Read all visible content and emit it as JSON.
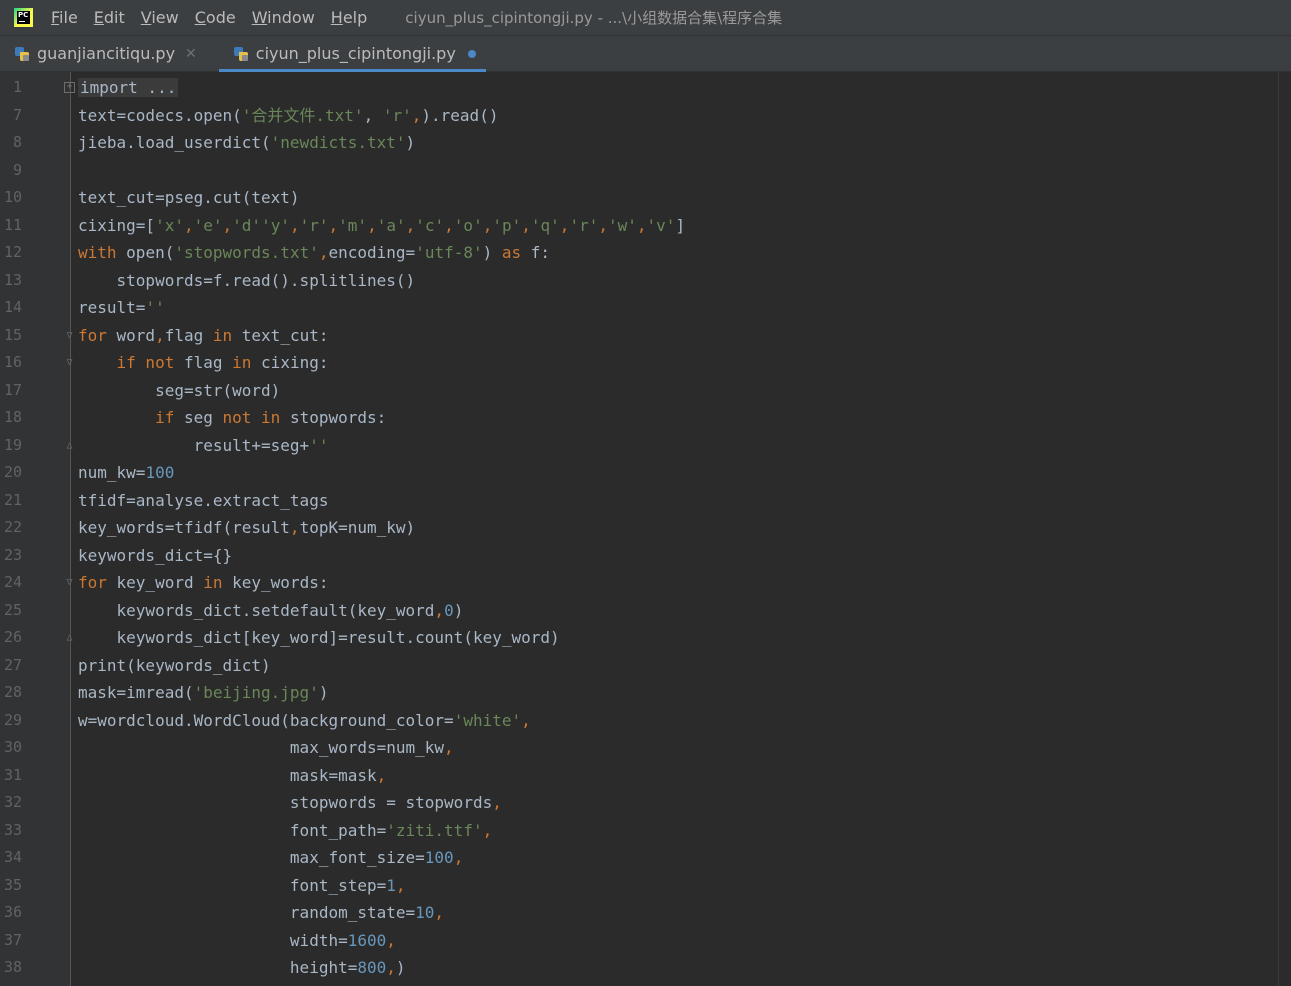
{
  "menu": {
    "items": [
      {
        "mnemonic": "F",
        "rest": "ile"
      },
      {
        "mnemonic": "E",
        "rest": "dit"
      },
      {
        "mnemonic": "V",
        "rest": "iew"
      },
      {
        "mnemonic": "C",
        "rest": "ode"
      },
      {
        "mnemonic": "W",
        "rest": "indow"
      },
      {
        "mnemonic": "H",
        "rest": "elp"
      }
    ],
    "window_title": "ciyun_plus_cipintongji.py - ...\\小组数据合集\\程序合集"
  },
  "tabs": [
    {
      "label": "guanjiancitiqu.py",
      "active": false,
      "modified": false
    },
    {
      "label": "ciyun_plus_cipintongji.py",
      "active": true,
      "modified": true
    }
  ],
  "editor": {
    "lines": [
      {
        "num": "1",
        "fold": "box-plus",
        "tokens": [
          [
            "f",
            "import ..."
          ]
        ]
      },
      {
        "num": "7",
        "fold": "",
        "tokens": [
          [
            "p",
            "text=codecs.open("
          ],
          [
            "s",
            "'合并文件.txt'"
          ],
          [
            "p",
            ", "
          ],
          [
            "s",
            "'r'"
          ],
          [
            "k",
            ","
          ],
          [
            "p",
            ").read()"
          ]
        ]
      },
      {
        "num": "8",
        "fold": "",
        "tokens": [
          [
            "p",
            "jieba.load_userdict("
          ],
          [
            "s",
            "'newdicts.txt'"
          ],
          [
            "p",
            ")"
          ]
        ]
      },
      {
        "num": "9",
        "fold": "",
        "tokens": []
      },
      {
        "num": "10",
        "fold": "",
        "tokens": [
          [
            "p",
            "text_cut=pseg.cut(text)"
          ]
        ]
      },
      {
        "num": "11",
        "fold": "",
        "tokens": [
          [
            "p",
            "cixing=["
          ],
          [
            "s",
            "'x'"
          ],
          [
            "k",
            ","
          ],
          [
            "s",
            "'e'"
          ],
          [
            "k",
            ","
          ],
          [
            "s",
            "'d'"
          ],
          [
            "s",
            "'y'"
          ],
          [
            "k",
            ","
          ],
          [
            "s",
            "'r'"
          ],
          [
            "k",
            ","
          ],
          [
            "s",
            "'m'"
          ],
          [
            "k",
            ","
          ],
          [
            "s",
            "'a'"
          ],
          [
            "k",
            ","
          ],
          [
            "s",
            "'c'"
          ],
          [
            "k",
            ","
          ],
          [
            "s",
            "'o'"
          ],
          [
            "k",
            ","
          ],
          [
            "s",
            "'p'"
          ],
          [
            "k",
            ","
          ],
          [
            "s",
            "'q'"
          ],
          [
            "k",
            ","
          ],
          [
            "s",
            "'r'"
          ],
          [
            "k",
            ","
          ],
          [
            "s",
            "'w'"
          ],
          [
            "k",
            ","
          ],
          [
            "s",
            "'v'"
          ],
          [
            "p",
            "]"
          ]
        ]
      },
      {
        "num": "12",
        "fold": "",
        "tokens": [
          [
            "k",
            "with "
          ],
          [
            "p",
            "open("
          ],
          [
            "s",
            "'stopwords.txt'"
          ],
          [
            "k",
            ","
          ],
          [
            "p",
            "encoding="
          ],
          [
            "s",
            "'utf-8'"
          ],
          [
            "p",
            ") "
          ],
          [
            "k",
            "as "
          ],
          [
            "p",
            "f:"
          ]
        ]
      },
      {
        "num": "13",
        "fold": "",
        "tokens": [
          [
            "p",
            "    stopwords=f.read().splitlines()"
          ]
        ]
      },
      {
        "num": "14",
        "fold": "",
        "tokens": [
          [
            "p",
            "result="
          ],
          [
            "s",
            "''"
          ]
        ]
      },
      {
        "num": "15",
        "fold": "open",
        "tokens": [
          [
            "k",
            "for "
          ],
          [
            "p",
            "word"
          ],
          [
            "k",
            ","
          ],
          [
            "p",
            "flag "
          ],
          [
            "k",
            "in "
          ],
          [
            "p",
            "text_cut:"
          ]
        ]
      },
      {
        "num": "16",
        "fold": "open",
        "tokens": [
          [
            "p",
            "    "
          ],
          [
            "k",
            "if not "
          ],
          [
            "p",
            "flag "
          ],
          [
            "k",
            "in "
          ],
          [
            "p",
            "cixing:"
          ]
        ]
      },
      {
        "num": "17",
        "fold": "",
        "tokens": [
          [
            "p",
            "        seg=str(word)"
          ]
        ]
      },
      {
        "num": "18",
        "fold": "",
        "tokens": [
          [
            "p",
            "        "
          ],
          [
            "k",
            "if "
          ],
          [
            "p",
            "seg "
          ],
          [
            "k",
            "not in "
          ],
          [
            "p",
            "stopwords:"
          ]
        ]
      },
      {
        "num": "19",
        "fold": "close",
        "tokens": [
          [
            "p",
            "            result+=seg+"
          ],
          [
            "s",
            "''"
          ]
        ]
      },
      {
        "num": "20",
        "fold": "",
        "tokens": [
          [
            "p",
            "num_kw="
          ],
          [
            "n",
            "100"
          ]
        ]
      },
      {
        "num": "21",
        "fold": "",
        "tokens": [
          [
            "p",
            "tfidf=analyse.extract_tags"
          ]
        ]
      },
      {
        "num": "22",
        "fold": "",
        "tokens": [
          [
            "p",
            "key_words=tfidf(result"
          ],
          [
            "k",
            ","
          ],
          [
            "p",
            "topK=num_kw)"
          ]
        ]
      },
      {
        "num": "23",
        "fold": "",
        "tokens": [
          [
            "p",
            "keywords_dict={}"
          ]
        ]
      },
      {
        "num": "24",
        "fold": "open",
        "tokens": [
          [
            "k",
            "for "
          ],
          [
            "p",
            "key_word "
          ],
          [
            "k",
            "in "
          ],
          [
            "p",
            "key_words:"
          ]
        ]
      },
      {
        "num": "25",
        "fold": "",
        "tokens": [
          [
            "p",
            "    keywords_dict.setdefault(key_word"
          ],
          [
            "k",
            ","
          ],
          [
            "n",
            "0"
          ],
          [
            "p",
            ")"
          ]
        ]
      },
      {
        "num": "26",
        "fold": "close",
        "tokens": [
          [
            "p",
            "    keywords_dict[key_word]=result.count(key_word)"
          ]
        ]
      },
      {
        "num": "27",
        "fold": "",
        "tokens": [
          [
            "p",
            "print(keywords_dict)"
          ]
        ]
      },
      {
        "num": "28",
        "fold": "",
        "tokens": [
          [
            "p",
            "mask=imread("
          ],
          [
            "s",
            "'beijing.jpg'"
          ],
          [
            "p",
            ")"
          ]
        ]
      },
      {
        "num": "29",
        "fold": "",
        "tokens": [
          [
            "p",
            "w=wordcloud.WordCloud(background_color="
          ],
          [
            "s",
            "'white'"
          ],
          [
            "k",
            ","
          ]
        ]
      },
      {
        "num": "30",
        "fold": "",
        "tokens": [
          [
            "p",
            "                      max_words=num_kw"
          ],
          [
            "k",
            ","
          ]
        ]
      },
      {
        "num": "31",
        "fold": "",
        "tokens": [
          [
            "p",
            "                      mask=mask"
          ],
          [
            "k",
            ","
          ]
        ]
      },
      {
        "num": "32",
        "fold": "",
        "tokens": [
          [
            "p",
            "                      stopwords = stopwords"
          ],
          [
            "k",
            ","
          ]
        ]
      },
      {
        "num": "33",
        "fold": "",
        "tokens": [
          [
            "p",
            "                      font_path="
          ],
          [
            "s",
            "'ziti.ttf'"
          ],
          [
            "k",
            ","
          ]
        ]
      },
      {
        "num": "34",
        "fold": "",
        "tokens": [
          [
            "p",
            "                      max_font_size="
          ],
          [
            "n",
            "100"
          ],
          [
            "k",
            ","
          ]
        ]
      },
      {
        "num": "35",
        "fold": "",
        "tokens": [
          [
            "p",
            "                      font_step="
          ],
          [
            "n",
            "1"
          ],
          [
            "k",
            ","
          ]
        ]
      },
      {
        "num": "36",
        "fold": "",
        "tokens": [
          [
            "p",
            "                      random_state="
          ],
          [
            "n",
            "10"
          ],
          [
            "k",
            ","
          ]
        ]
      },
      {
        "num": "37",
        "fold": "",
        "tokens": [
          [
            "p",
            "                      width="
          ],
          [
            "n",
            "1600"
          ],
          [
            "k",
            ","
          ]
        ]
      },
      {
        "num": "38",
        "fold": "",
        "tokens": [
          [
            "p",
            "                      height="
          ],
          [
            "n",
            "800"
          ],
          [
            "k",
            ","
          ],
          [
            "p",
            ")"
          ]
        ]
      }
    ]
  }
}
